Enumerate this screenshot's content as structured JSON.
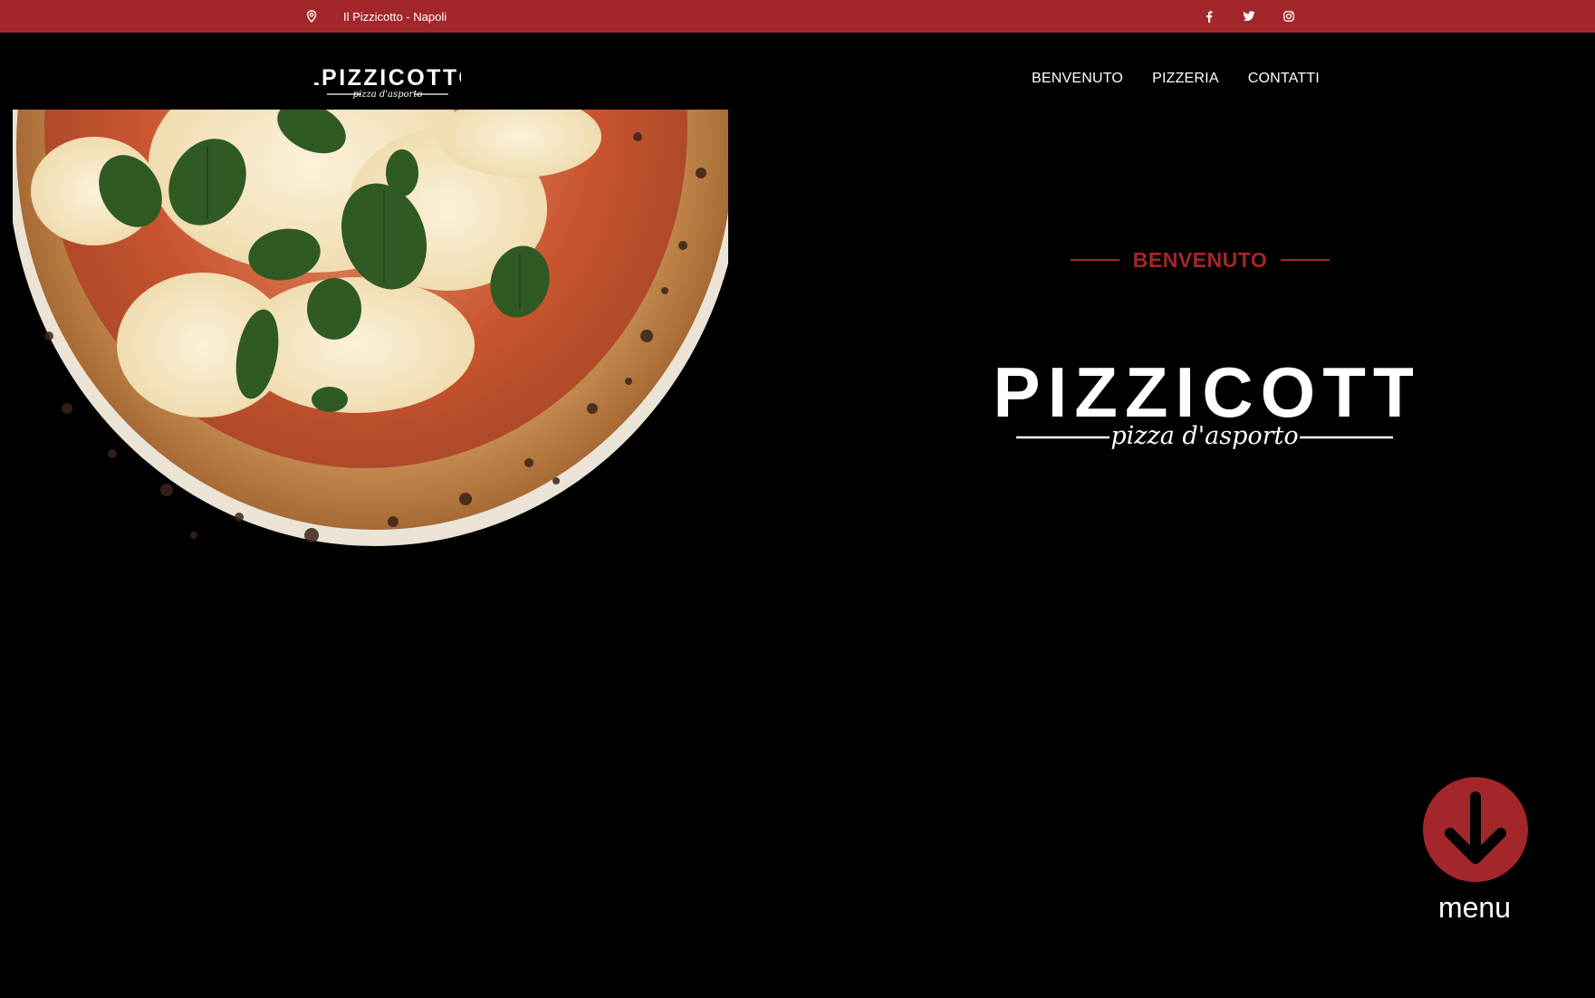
{
  "topbar": {
    "location_icon": "map-pin-icon",
    "location_text": "Il Pizzicotto - Napoli",
    "social": [
      {
        "icon": "facebook-icon",
        "glyph": "f"
      },
      {
        "icon": "twitter-icon",
        "glyph": "t"
      },
      {
        "icon": "instagram-icon",
        "glyph": "◎"
      }
    ]
  },
  "header": {
    "logo": {
      "wordmark": "ILPIZZICOTTO",
      "tagline": "pizza d'asporto"
    },
    "nav": [
      "BENVENUTO",
      "PIZZERIA",
      "CONTATTI"
    ]
  },
  "hero": {
    "eyebrow": "BENVENUTO",
    "logo": {
      "wordmark": "ILPIZZICOTTO",
      "tagline": "pizza d'asporto"
    }
  },
  "menu_button": {
    "icon": "arrow-down-icon",
    "label": "menu"
  },
  "colors": {
    "accent": "#a3262b",
    "background": "#000000",
    "text": "#ffffff"
  }
}
